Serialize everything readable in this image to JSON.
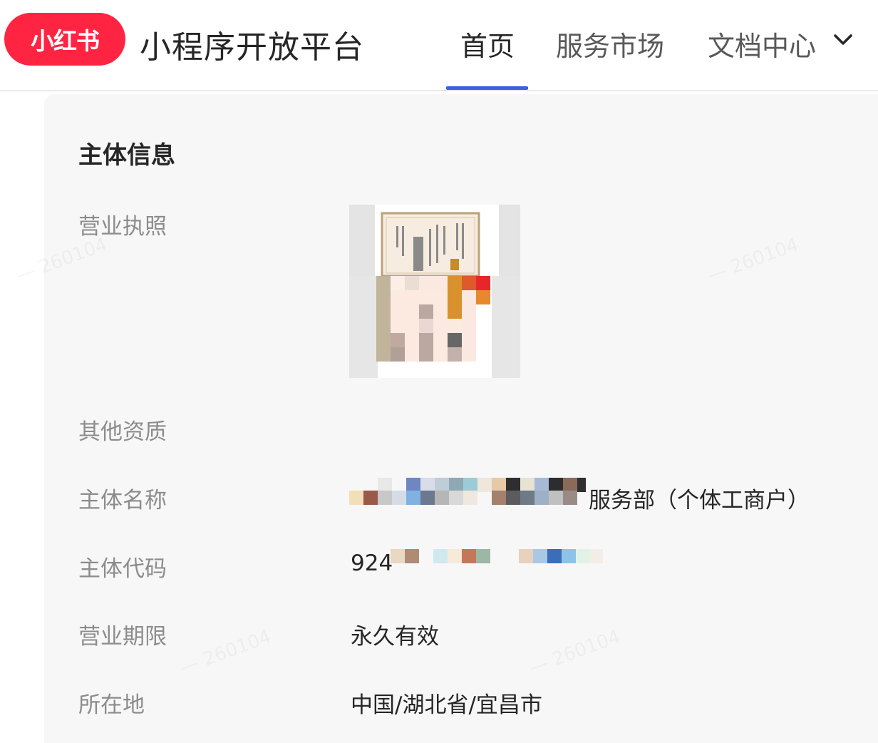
{
  "header": {
    "logo_text": "小红书",
    "platform_title": "小程序开放平台",
    "nav": {
      "home": "首页",
      "market": "服务市场",
      "docs": "文档中心"
    },
    "active_nav": "home",
    "colors": {
      "brand": "#ff2442",
      "active_underline": "#3a5fe0"
    }
  },
  "entity_info": {
    "section_title": "主体信息",
    "fields": {
      "business_license": {
        "label": "营业执照"
      },
      "other_qualifications": {
        "label": "其他资质"
      },
      "entity_name": {
        "label": "主体名称",
        "value_visible_suffix": "服务部（个体工商户）"
      },
      "entity_code": {
        "label": "主体代码",
        "value_visible_prefix": "924"
      },
      "business_term": {
        "label": "营业期限",
        "value": "永久有效"
      },
      "location": {
        "label": "所在地",
        "value": "中国/湖北省/宜昌市"
      }
    }
  }
}
